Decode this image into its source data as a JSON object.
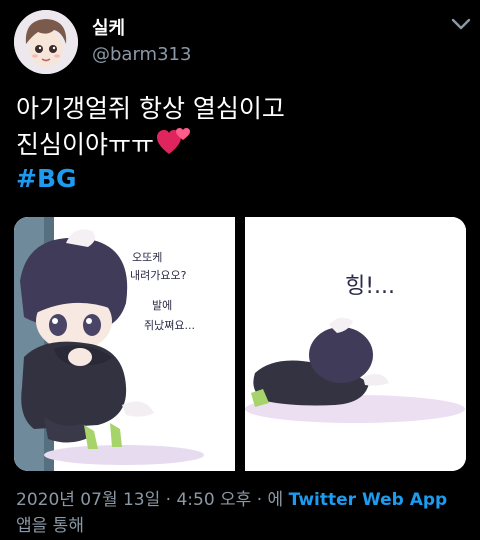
{
  "user": {
    "display_name": "실케",
    "handle": "@barm313"
  },
  "tweet": {
    "line1": "아기갱얼쥐 항상 열심이고",
    "line2": "진심이야ㅠㅠ",
    "hashtag": "#BG"
  },
  "media": {
    "left_panel": {
      "bubble1_line1": "오또케",
      "bubble1_line2": "내려가요오?",
      "bubble2_line1": "발에",
      "bubble2_line2": "쥐났쪄요..."
    },
    "right_panel": {
      "sound_text": "힝!..."
    }
  },
  "meta": {
    "timestamp": "2020년 07월 13일 · 4:50 오후 · 에",
    "source": "Twitter Web App",
    "suffix": "앱을 통해"
  },
  "colors": {
    "background": "#000000",
    "link": "#1d9bf0",
    "muted": "#8b98a5",
    "heart": "#e0245e"
  }
}
